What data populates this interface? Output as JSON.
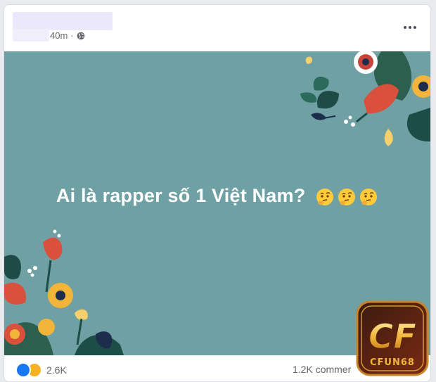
{
  "post": {
    "timestamp": "40m",
    "separator": "·",
    "privacy_icon": "globe-icon",
    "more_icon": "more-options-icon",
    "background_color": "#6ea0a4",
    "text": "Ai là rapper số 1 Việt Nam?",
    "emojis": [
      "thinking-face",
      "thinking-face",
      "thinking-face"
    ]
  },
  "footer": {
    "reaction_icons": [
      "like-icon",
      "haha-icon"
    ],
    "reaction_count": "2.6K",
    "comment_count": "1.2K commer"
  },
  "watermark": {
    "logo_text": "CF",
    "brand_text": "CFUN68"
  }
}
